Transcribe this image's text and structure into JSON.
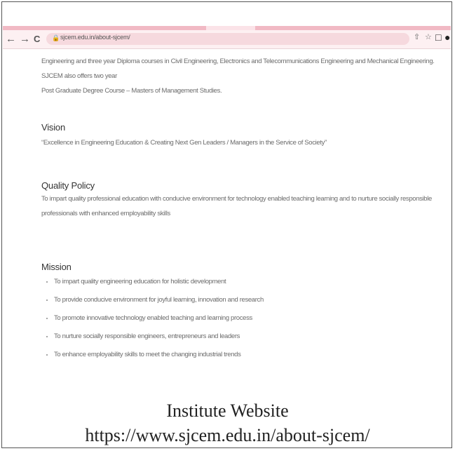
{
  "browser": {
    "nav_back": "←",
    "nav_forward": "→",
    "nav_reload": "C",
    "url": "sjcem.edu.in/about-sjcem/",
    "icons": [
      "share-icon",
      "star-icon",
      "sidebar-icon",
      "profile-icon"
    ]
  },
  "page": {
    "intro_line1": "Engineering and three year Diploma courses in Civil Engineering, Electronics and Telecommunications Engineering and Mechanical Engineering. SJCEM also offers two year",
    "intro_line2": "Post Graduate Degree Course – Masters of Management Studies.",
    "vision_heading": "Vision",
    "vision_text": "“Excellence in Engineering Education & Creating Next Gen Leaders / Managers in the Service of Society”",
    "quality_heading": "Quality Policy",
    "quality_text": "To impart quality professional education with conducive environment for technology enabled teaching learning and to nurture socially responsible professionals with enhanced employability skills",
    "mission_heading": "Mission",
    "mission_items": [
      "To impart quality engineering education for holistic development",
      "To provide conducive environment for joyful learning, innovation and research",
      "To promote innovative technology enabled teaching and learning process",
      "To nurture socially responsible engineers, entrepreneurs and leaders",
      "To enhance employability skills to meet the changing industrial trends"
    ]
  },
  "caption": {
    "line1": "Institute Website",
    "line2": "https://www.sjcem.edu.in/about-sjcem/"
  },
  "colors": {
    "tab_strip": "#f1b9c4",
    "address_bar_bg": "#fdf0f2",
    "omnibox_bg": "#f6d9de"
  }
}
